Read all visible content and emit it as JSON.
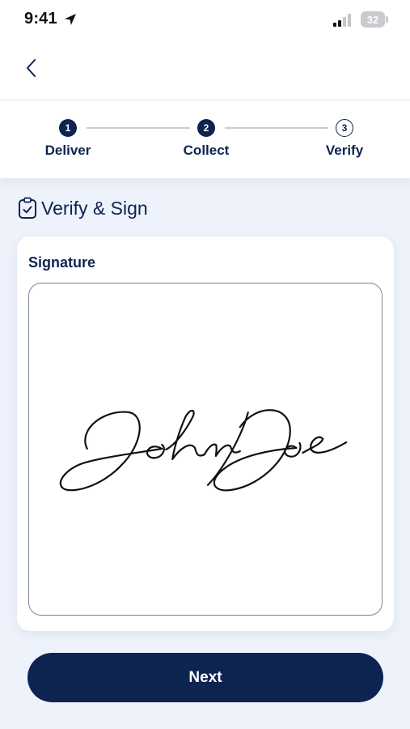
{
  "status_bar": {
    "time": "9:41",
    "battery": "32",
    "icons": [
      "location-arrow-icon",
      "signal-icon",
      "battery-icon"
    ]
  },
  "header": {
    "back_icon": "chevron-left-icon"
  },
  "stepper": {
    "steps": [
      {
        "number": "1",
        "label": "Deliver",
        "state": "completed"
      },
      {
        "number": "2",
        "label": "Collect",
        "state": "completed"
      },
      {
        "number": "3",
        "label": "Verify",
        "state": "current"
      }
    ]
  },
  "section": {
    "title": "Verify & Sign",
    "icon": "clipboard-check-icon"
  },
  "signature": {
    "label": "Signature",
    "signed_name": "John Doe"
  },
  "actions": {
    "next_label": "Next"
  },
  "colors": {
    "primary": "#0d2350",
    "background": "#eef2fb",
    "surface": "#ffffff",
    "border": "#7c8698",
    "step_line": "#c9ccd3"
  }
}
